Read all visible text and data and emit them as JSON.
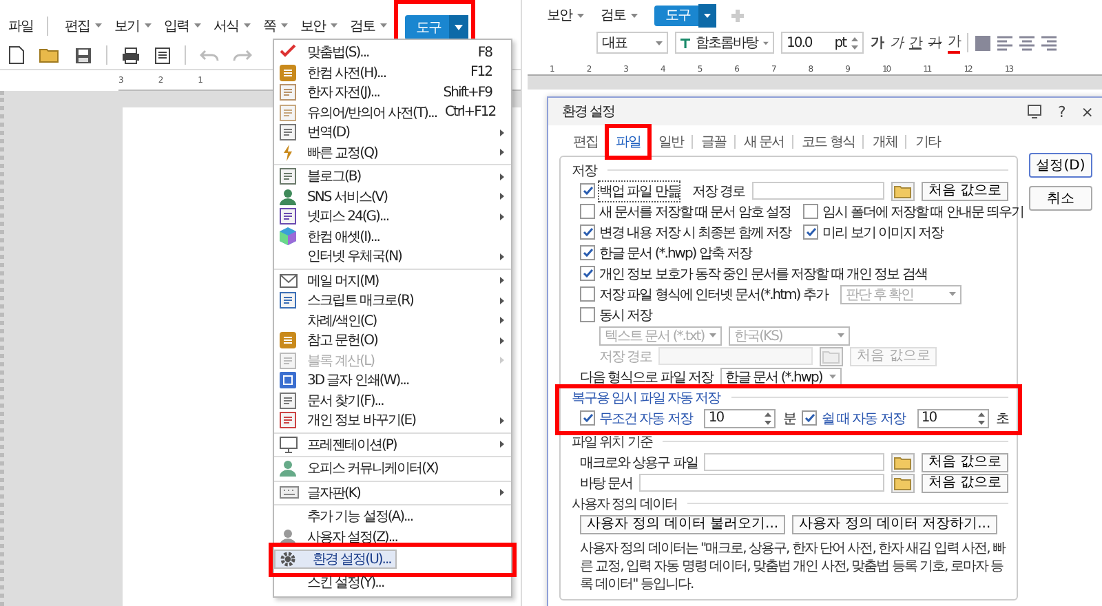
{
  "left": {
    "menubar": [
      {
        "label": "파일",
        "selected": false,
        "dropdown": false
      },
      {
        "label": "편집",
        "selected": false,
        "dropdown": true
      },
      {
        "label": "보기",
        "selected": false,
        "dropdown": true
      },
      {
        "label": "입력",
        "selected": false,
        "dropdown": true
      },
      {
        "label": "서식",
        "selected": false,
        "dropdown": true
      },
      {
        "label": "쪽",
        "selected": false,
        "dropdown": true
      },
      {
        "label": "보안",
        "selected": false,
        "dropdown": true
      },
      {
        "label": "검토",
        "selected": false,
        "dropdown": true
      },
      {
        "label": "도구",
        "selected": true,
        "dropdown": true,
        "annotated": true
      }
    ],
    "ruler": [
      "3",
      "2",
      "1"
    ],
    "tools_menu": [
      {
        "kind": "item",
        "label": "맞춤법(S)...",
        "shortcut": "F8",
        "submenu": false,
        "disabled": false,
        "selected": false,
        "annotated": false
      },
      {
        "kind": "item",
        "label": "한컴 사전(H)...",
        "shortcut": "F12",
        "submenu": false,
        "disabled": false,
        "selected": false,
        "annotated": false
      },
      {
        "kind": "item",
        "label": "한자 자전(J)...",
        "shortcut": "Shift+F9",
        "submenu": false,
        "disabled": false,
        "selected": false,
        "annotated": false
      },
      {
        "kind": "item",
        "label": "유의어/반의어 사전(T)...",
        "shortcut": "Ctrl+F12",
        "submenu": false,
        "disabled": false,
        "selected": false,
        "annotated": false
      },
      {
        "kind": "item",
        "label": "번역(D)",
        "submenu": true,
        "disabled": false,
        "selected": false,
        "annotated": false
      },
      {
        "kind": "item",
        "label": "빠른 교정(Q)",
        "submenu": true,
        "disabled": false,
        "selected": false,
        "annotated": false
      },
      {
        "kind": "separator"
      },
      {
        "kind": "item",
        "label": "블로그(B)",
        "submenu": true,
        "disabled": false,
        "selected": false,
        "annotated": false
      },
      {
        "kind": "item",
        "label": "SNS 서비스(V)",
        "submenu": true,
        "disabled": false,
        "selected": false,
        "annotated": false
      },
      {
        "kind": "item",
        "label": "넷피스 24(G)...",
        "submenu": true,
        "disabled": false,
        "selected": false,
        "annotated": false
      },
      {
        "kind": "item",
        "label": "한컴 애셋(I)...",
        "submenu": false,
        "disabled": false,
        "selected": false,
        "annotated": false
      },
      {
        "kind": "item",
        "label": "인터넷 우체국(N)",
        "submenu": true,
        "disabled": false,
        "selected": false,
        "annotated": false
      },
      {
        "kind": "separator"
      },
      {
        "kind": "item",
        "label": "메일 머지(M)",
        "submenu": true,
        "disabled": false,
        "selected": false,
        "annotated": false
      },
      {
        "kind": "item",
        "label": "스크립트 매크로(R)",
        "submenu": true,
        "disabled": false,
        "selected": false,
        "annotated": false
      },
      {
        "kind": "item",
        "label": "차례/색인(C)",
        "submenu": true,
        "disabled": false,
        "selected": false,
        "annotated": false
      },
      {
        "kind": "item",
        "label": "참고 문헌(O)",
        "submenu": true,
        "disabled": false,
        "selected": false,
        "annotated": false
      },
      {
        "kind": "item",
        "label": "블록 계산(L)",
        "submenu": true,
        "disabled": true,
        "selected": false,
        "annotated": false
      },
      {
        "kind": "item",
        "label": "3D 글자 인쇄(W)...",
        "submenu": false,
        "disabled": false,
        "selected": false,
        "annotated": false
      },
      {
        "kind": "item",
        "label": "문서 찾기(F)...",
        "submenu": false,
        "disabled": false,
        "selected": false,
        "annotated": false
      },
      {
        "kind": "item",
        "label": "개인 정보 바꾸기(E)",
        "submenu": true,
        "disabled": false,
        "selected": false,
        "annotated": false
      },
      {
        "kind": "separator"
      },
      {
        "kind": "item",
        "label": "프레젠테이션(P)",
        "submenu": true,
        "disabled": false,
        "selected": false,
        "annotated": false
      },
      {
        "kind": "separator"
      },
      {
        "kind": "item",
        "label": "오피스 커뮤니케이터(X)",
        "submenu": false,
        "disabled": false,
        "selected": false,
        "annotated": false
      },
      {
        "kind": "separator"
      },
      {
        "kind": "item",
        "label": "글자판(K)",
        "submenu": true,
        "disabled": false,
        "selected": false,
        "annotated": false
      },
      {
        "kind": "separator"
      },
      {
        "kind": "item",
        "label": "추가 기능 설정(A)...",
        "submenu": false,
        "disabled": false,
        "selected": false,
        "annotated": false
      },
      {
        "kind": "item",
        "label": "사용자 설정(Z)...",
        "submenu": false,
        "disabled": false,
        "selected": false,
        "annotated": false
      },
      {
        "kind": "item",
        "label": "환경 설정(U)...",
        "submenu": false,
        "disabled": false,
        "selected": true,
        "annotated": true
      },
      {
        "kind": "item",
        "label": "스킨 설정(Y)...",
        "submenu": false,
        "disabled": false,
        "selected": false,
        "annotated": false
      }
    ]
  },
  "right": {
    "menubar": [
      {
        "label": "보안",
        "selected": false
      },
      {
        "label": "검토",
        "selected": false
      },
      {
        "label": "도구",
        "selected": true
      }
    ],
    "toolbar": {
      "style": "대표",
      "font": "함초롬바탕",
      "size": "10.0",
      "unit": "pt",
      "format_buttons": [
        "가",
        "가",
        "간",
        "가",
        "가"
      ]
    },
    "ruler": [
      "1",
      "2",
      "3",
      "4",
      "5",
      "6",
      "7",
      "8",
      "9",
      "10",
      "11",
      "12",
      "13"
    ],
    "dialog": {
      "title": "환경 설정",
      "title_buttons": [
        "?",
        "×"
      ],
      "tabs": [
        {
          "label": "편집",
          "selected": false,
          "annotated": false
        },
        {
          "label": "파일",
          "selected": true,
          "annotated": true
        },
        {
          "label": "일반",
          "selected": false,
          "annotated": false
        },
        {
          "label": "글꼴",
          "selected": false,
          "annotated": false
        },
        {
          "label": "새 문서",
          "selected": false,
          "annotated": false
        },
        {
          "label": "코드 형식",
          "selected": false,
          "annotated": false
        },
        {
          "label": "개체",
          "selected": false,
          "annotated": false
        },
        {
          "label": "기타",
          "selected": false,
          "annotated": false
        }
      ],
      "buttons": [
        {
          "label": "설정(D)",
          "default": true
        },
        {
          "label": "취소",
          "default": false
        }
      ],
      "sections": [
        {
          "title": "저장",
          "highlight": false,
          "rows": [
            {
              "controls": [
                {
                  "kind": "checkbox",
                  "label": "백업 파일 만듦",
                  "checked": true,
                  "focused": true,
                  "disabled": false
                },
                {
                  "kind": "label",
                  "text": "저장 경로",
                  "disabled": false
                },
                {
                  "kind": "field",
                  "disabled": false
                },
                {
                  "kind": "browse",
                  "disabled": false
                },
                {
                  "kind": "button",
                  "label": "처음 값으로",
                  "disabled": false
                }
              ]
            },
            {
              "controls": [
                {
                  "kind": "checkbox",
                  "label": "새 문서를 저장할 때 문서 암호 설정",
                  "checked": false,
                  "focused": false,
                  "disabled": false
                },
                {
                  "kind": "checkbox",
                  "label": "임시 폴더에 저장할 때 안내문 띄우기",
                  "checked": false,
                  "focused": false,
                  "disabled": false
                }
              ]
            },
            {
              "controls": [
                {
                  "kind": "checkbox",
                  "label": "변경 내용 저장 시 최종본 함께 저장",
                  "checked": true,
                  "focused": false,
                  "disabled": false
                },
                {
                  "kind": "checkbox",
                  "label": "미리 보기 이미지 저장",
                  "checked": true,
                  "focused": false,
                  "disabled": false
                }
              ]
            },
            {
              "controls": [
                {
                  "kind": "checkbox",
                  "label": "한글 문서 (*.hwp) 압축 저장",
                  "checked": true,
                  "focused": false,
                  "disabled": false
                }
              ]
            },
            {
              "controls": [
                {
                  "kind": "checkbox",
                  "label": "개인 정보 보호가 동작 중인 문서를 저장할 때 개인 정보 검색",
                  "checked": true,
                  "focused": false,
                  "disabled": false
                }
              ]
            },
            {
              "controls": [
                {
                  "kind": "checkbox",
                  "label": "저장 파일 형식에 인터넷 문서(*.htm) 추가",
                  "checked": false,
                  "focused": false,
                  "disabled": false
                },
                {
                  "kind": "select",
                  "value": "판단 후 확인",
                  "disabled": true
                }
              ]
            },
            {
              "controls": [
                {
                  "kind": "checkbox",
                  "label": "동시 저장",
                  "checked": false,
                  "focused": false,
                  "disabled": false
                }
              ],
              "children": [
                {
                  "controls": [
                    {
                      "kind": "select",
                      "value": "텍스트 문서 (*.txt)",
                      "disabled": true
                    },
                    {
                      "kind": "select",
                      "value": "한국(KS)",
                      "disabled": true
                    }
                  ]
                },
                {
                  "controls": [
                    {
                      "kind": "label",
                      "text": "저장 경로",
                      "disabled": true
                    },
                    {
                      "kind": "field",
                      "disabled": true
                    },
                    {
                      "kind": "browse",
                      "disabled": true
                    },
                    {
                      "kind": "button",
                      "label": "처음 값으로",
                      "disabled": true
                    }
                  ]
                }
              ]
            },
            {
              "controls": [
                {
                  "kind": "label",
                  "text": "다음 형식으로 파일 저장",
                  "disabled": false
                },
                {
                  "kind": "select",
                  "value": "한글 문서 (*.hwp)",
                  "disabled": false
                }
              ]
            }
          ]
        },
        {
          "title": "복구용 임시 파일 자동 저장",
          "annotated": true,
          "highlight": true,
          "rows": [
            {
              "controls": [
                {
                  "kind": "checkbox",
                  "label": "무조건 자동 저장",
                  "checked": true,
                  "focused": false,
                  "disabled": false
                },
                {
                  "kind": "spin",
                  "value": "10",
                  "disabled": false
                },
                {
                  "kind": "label",
                  "text": "분",
                  "disabled": false
                },
                {
                  "kind": "checkbox",
                  "label": "쉴 때 자동 저장",
                  "checked": true,
                  "focused": false,
                  "disabled": false
                },
                {
                  "kind": "spin",
                  "value": "10",
                  "disabled": false
                },
                {
                  "kind": "label",
                  "text": "초",
                  "disabled": false
                }
              ]
            }
          ]
        },
        {
          "title": "파일 위치 기준",
          "highlight": false,
          "rows": [
            {
              "controls": [
                {
                  "kind": "label",
                  "text": "매크로와 상용구 파일",
                  "disabled": false
                },
                {
                  "kind": "field",
                  "disabled": false
                },
                {
                  "kind": "browse",
                  "disabled": false
                },
                {
                  "kind": "button",
                  "label": "처음 값으로",
                  "disabled": false
                }
              ]
            },
            {
              "controls": [
                {
                  "kind": "label",
                  "text": "바탕 문서",
                  "disabled": false
                },
                {
                  "kind": "field",
                  "disabled": false
                },
                {
                  "kind": "browse",
                  "disabled": false
                },
                {
                  "kind": "button",
                  "label": "처음 값으로",
                  "disabled": false
                }
              ]
            }
          ]
        },
        {
          "title": "사용자 정의 데이터",
          "highlight": false,
          "rows": [
            {
              "controls": [
                {
                  "kind": "button",
                  "label": "사용자 정의 데이터 불러오기...",
                  "disabled": false
                },
                {
                  "kind": "button",
                  "label": "사용자 정의 데이터 저장하기...",
                  "disabled": false
                }
              ]
            }
          ],
          "note": "사용자 정의 데이터는 \"매크로, 상용구, 한자 단어 사전, 한자 새김 입력 사전, 빠른 교정, 입력 자동 명령 데이터, 맞춤법 개인 사전, 맞춤법 등록 기호, 로마자 등록 데이터\" 등입니다."
        }
      ]
    }
  }
}
